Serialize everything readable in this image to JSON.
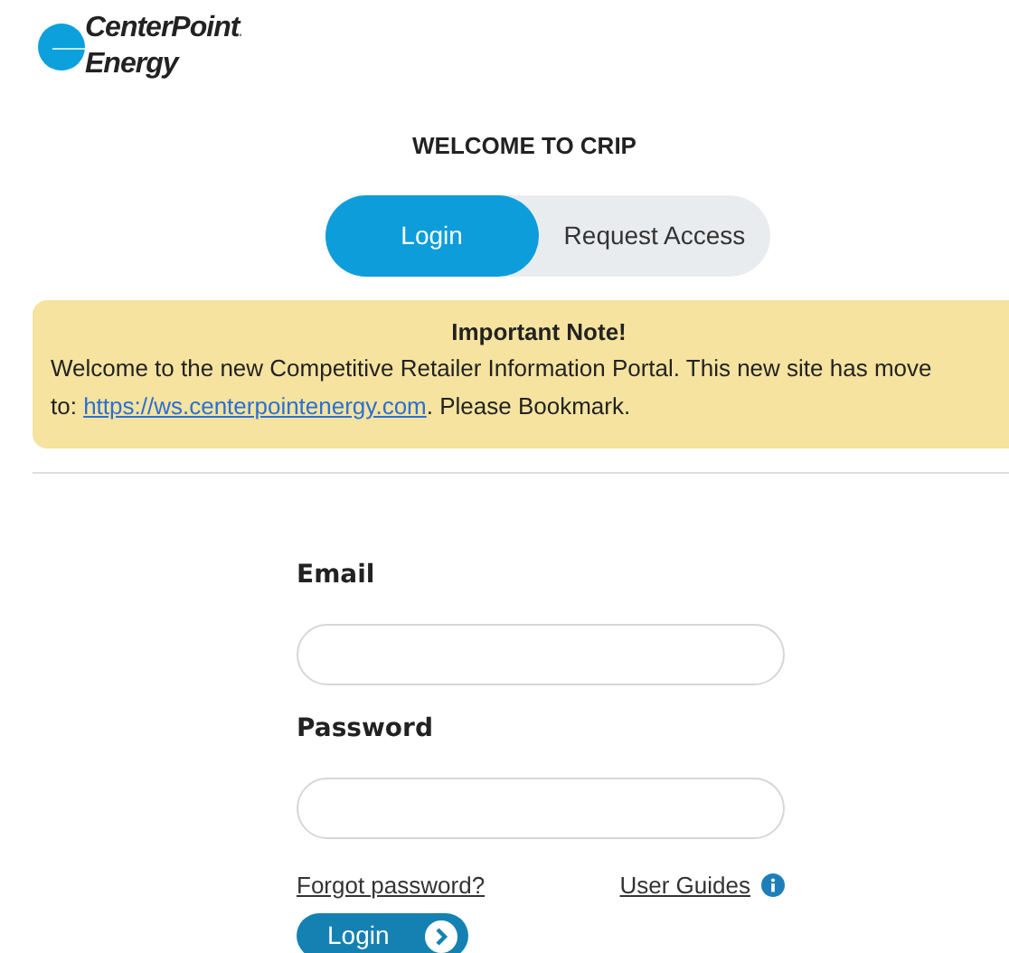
{
  "logo": {
    "line_1": "CenterPoint",
    "mark": ".",
    "line_2": "Energy"
  },
  "title": "WELCOME TO CRIP",
  "tabs": [
    {
      "label": "Login",
      "selected": true
    },
    {
      "label": "Request Access",
      "selected": false
    }
  ],
  "note": {
    "heading": "Important Note!",
    "line_1": "Welcome to the new Competitive Retailer Information Portal. This new site has move",
    "line_2_prefix": "to: ",
    "link": "https://ws.centerpointenergy.com",
    "line_2_suffix": ". Please Bookmark."
  },
  "form": {
    "fields": [
      {
        "label": "Email"
      },
      {
        "label": "Password"
      }
    ],
    "forgot_link": "Forgot password?",
    "guides_link": "User Guides",
    "submit": "Login"
  }
}
